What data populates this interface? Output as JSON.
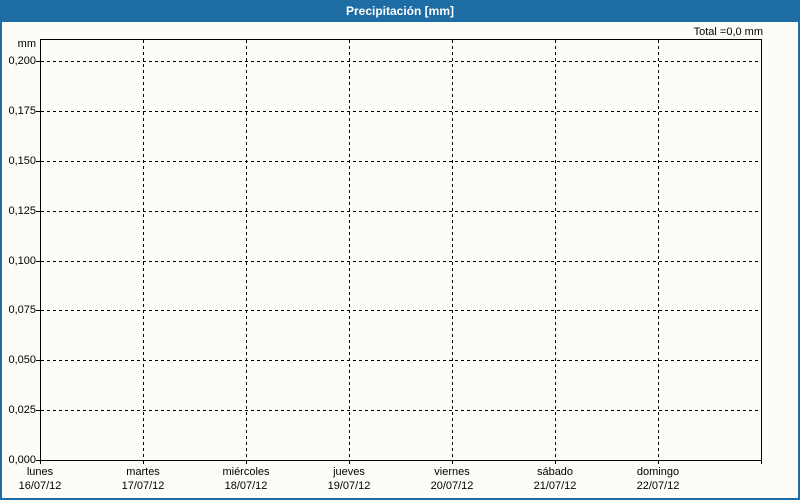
{
  "window": {
    "title": "Precipitación [mm]"
  },
  "summary": {
    "total": "Total =0,0 mm"
  },
  "colors": {
    "accent": "#1d6da4",
    "titlebar_text": "#ffffff",
    "background": "#fdfdf7",
    "grid": "#000000",
    "text": "#000000"
  },
  "chart_data": {
    "type": "bar",
    "title": "Precipitación [mm]",
    "ylabel": "mm",
    "total_label": "Total =0,0 mm",
    "total_value_mm": 0.0,
    "ylim": [
      0,
      0.21
    ],
    "grid": "dashed",
    "legend": "none",
    "y_ticks": [
      {
        "value": 0.2,
        "label": "0,200"
      },
      {
        "value": 0.175,
        "label": "0,175"
      },
      {
        "value": 0.15,
        "label": "0,150"
      },
      {
        "value": 0.125,
        "label": "0,125"
      },
      {
        "value": 0.1,
        "label": "0,100"
      },
      {
        "value": 0.075,
        "label": "0,075"
      },
      {
        "value": 0.05,
        "label": "0,050"
      },
      {
        "value": 0.025,
        "label": "0,025"
      },
      {
        "value": 0.0,
        "label": "0,000"
      }
    ],
    "categories": [
      "lunes",
      "martes",
      "miércoles",
      "jueves",
      "viernes",
      "sábado",
      "domingo"
    ],
    "category_dates": [
      "16/07/12",
      "17/07/12",
      "18/07/12",
      "19/07/12",
      "20/07/12",
      "21/07/12",
      "22/07/12"
    ],
    "series": [
      {
        "name": "Precipitación",
        "values": [
          0,
          0,
          0,
          0,
          0,
          0,
          0
        ]
      }
    ]
  }
}
